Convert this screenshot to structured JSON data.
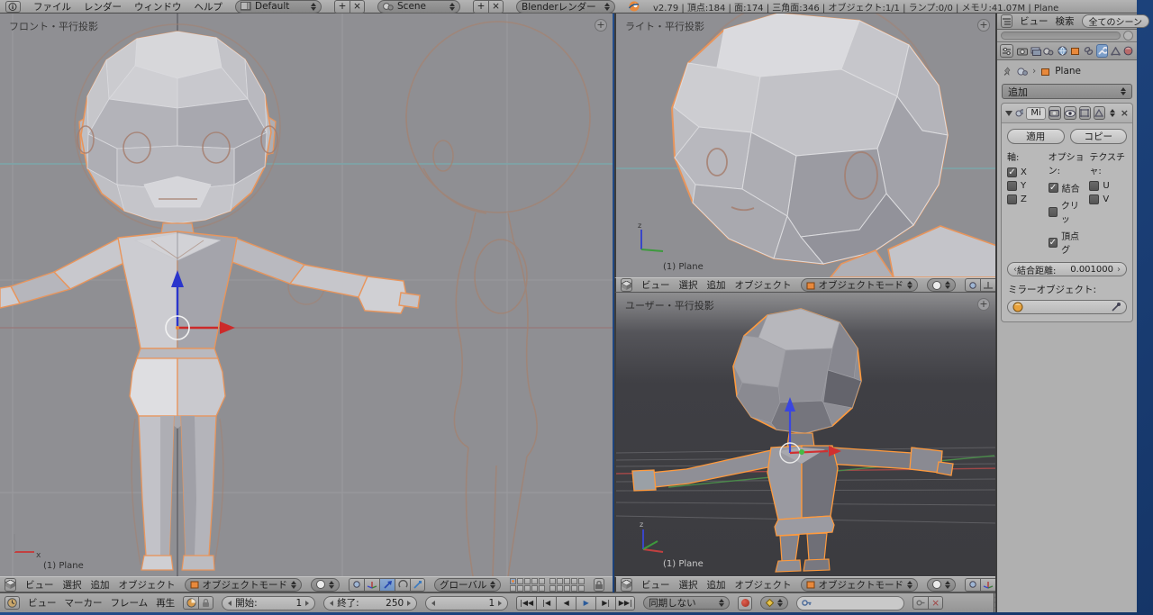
{
  "topbar": {
    "menus": [
      "ファイル",
      "レンダー",
      "ウィンドウ",
      "ヘルプ"
    ],
    "layout_name": "Default",
    "scene_name": "Scene",
    "engine": "Blenderレンダー",
    "stats": "v2.79 | 頂点:184 | 面:174 | 三角面:346 | オブジェクト:1/1 | ランプ:0/0 | メモリ:41.07M | Plane"
  },
  "viewport_header": {
    "menus": [
      "ビュー",
      "選択",
      "追加",
      "オブジェクト"
    ],
    "mode": "オブジェクトモード",
    "orientation": "グローバル"
  },
  "viewports": {
    "front": {
      "label": "フロント・平行投影",
      "object_info": "(1) Plane"
    },
    "right": {
      "label": "ライト・平行投影",
      "object_info": "(1) Plane"
    },
    "user": {
      "label": "ユーザー・平行投影",
      "object_info": "(1) Plane"
    }
  },
  "timeline": {
    "menus": [
      "ビュー",
      "マーカー",
      "フレーム",
      "再生"
    ],
    "start_label": "開始:",
    "start_value": "1",
    "end_label": "終了:",
    "end_value": "250",
    "current_frame": "1",
    "sync_mode": "同期しない",
    "playback": [
      "|◀◀",
      "|◀",
      "◀",
      "▶",
      "▶|",
      "▶▶|"
    ]
  },
  "outliner": {
    "view_menu": "ビュー",
    "search_menu": "検索",
    "filter": "全てのシーン"
  },
  "properties": {
    "object_name": "Plane",
    "add_label": "追加",
    "modifier": {
      "name": "Mi",
      "apply_label": "適用",
      "copy_label": "コピー",
      "axis_col": "軸:",
      "options_col": "オプション:",
      "texture_col": "テクスチャ:",
      "axes": [
        {
          "label": "X",
          "checked": true
        },
        {
          "label": "Y",
          "checked": false
        },
        {
          "label": "Z",
          "checked": false
        }
      ],
      "options": [
        {
          "label": "結合",
          "checked": true
        },
        {
          "label": "クリッ",
          "checked": false
        },
        {
          "label": "頂点グ",
          "checked": true
        }
      ],
      "textures": [
        {
          "label": "U",
          "checked": false
        },
        {
          "label": "V",
          "checked": false
        }
      ],
      "merge_label": "結合距離:",
      "merge_value": "0.001000",
      "mirror_object_label": "ミラーオブジェクト:"
    }
  },
  "glyphs": {
    "check": "✓",
    "plus": "+",
    "close": "×",
    "arrow_left": "‹",
    "arrow_right": "›",
    "crumb_sep": "›"
  },
  "colors": {
    "selection_outline": "#e8955c",
    "selection_outline_dark_vp": "#ff9a3d",
    "axis_x_red": "#cc2a2a",
    "axis_z_blue": "#2a35cc",
    "axis_y_green": "#3d9a3d",
    "viewport_bg_light": "#8f8f93",
    "viewport_bg_dark": "#3d3d41",
    "panel_active_blue": "#7d9fc9",
    "desktop_blue": "#1d4483"
  }
}
